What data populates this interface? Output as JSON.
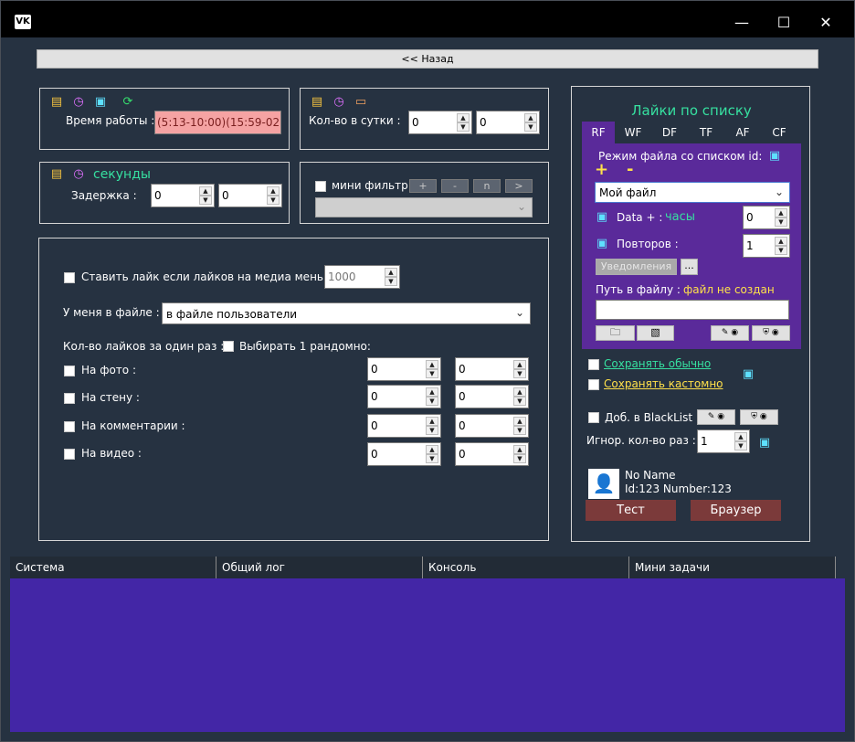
{
  "window": {
    "logo": "VK",
    "minimize": "—",
    "maximize": "☐",
    "close": "✕"
  },
  "top": {
    "back_label": "<< Назад"
  },
  "work_panel": {
    "label": "Время работы :",
    "value": "(5:13-10:00)(15:59-02"
  },
  "daily_panel": {
    "label": "Кол-во в сутки :",
    "v1": "0",
    "v2": "0"
  },
  "delay_panel": {
    "unit": "секунды",
    "label": "Задержка :",
    "v1": "0",
    "v2": "0"
  },
  "mini_filter": {
    "label": "мини фильтр",
    "btn_plus": "+",
    "btn_minus": "-",
    "btn_n": "n",
    "btn_next": ">"
  },
  "main": {
    "like_if_less": {
      "label": "Ставить лайк если лайков на медиа меньше",
      "value": "1000"
    },
    "file_mode": {
      "label": "У меня в файле :",
      "selected": "в файле пользователи"
    },
    "likes_per_run": {
      "label": "Кол-во лайков за один раз :",
      "random_label": "Выбирать 1 рандомно:"
    },
    "rows": [
      {
        "label": "На фото :",
        "v1": "0",
        "v2": "0"
      },
      {
        "label": "На стену :",
        "v1": "0",
        "v2": "0"
      },
      {
        "label": "На комментарии :",
        "v1": "0",
        "v2": "0"
      },
      {
        "label": "На видео :",
        "v1": "0",
        "v2": "0"
      }
    ]
  },
  "right": {
    "title": "Лайки по списку",
    "tabs": [
      "RF",
      "WF",
      "DF",
      "TF",
      "AF",
      "CF"
    ],
    "file_mode_label": "Режим файла  со списком id:",
    "plus": "+",
    "minus": "-",
    "file_select": "Мой файл",
    "data_label": "Data + :",
    "data_unit": "часы",
    "data_value": "0",
    "repeats_label": "Повторов :",
    "repeats_value": "1",
    "notify_label": "Уведомления",
    "dots_label": "...",
    "path_label": "Путь в файлу  :",
    "path_status": "файл не создан",
    "save_normal": "Сохранять обычно",
    "save_custom": "Сохранять кастомно",
    "blacklist_label": "Доб. в BlackList",
    "ignore_label": "Игнор. кол-во раз :",
    "ignore_value": "1",
    "profile_name": "No Name",
    "profile_id": "Id:123 Number:123",
    "test_label": "Тест",
    "browser_label": "Браузер"
  },
  "log_tabs": [
    "Система",
    "Общий лог",
    "Консоль",
    "Мини задачи"
  ],
  "colors": {
    "bg": "#263241",
    "purple": "#5a2a9a",
    "log_bg": "#4326a6",
    "accent_green": "#36e0a0",
    "warning_yellow": "#ffe04a",
    "input_pink": "#f5a3a3",
    "button_red": "#7b3a3a"
  }
}
